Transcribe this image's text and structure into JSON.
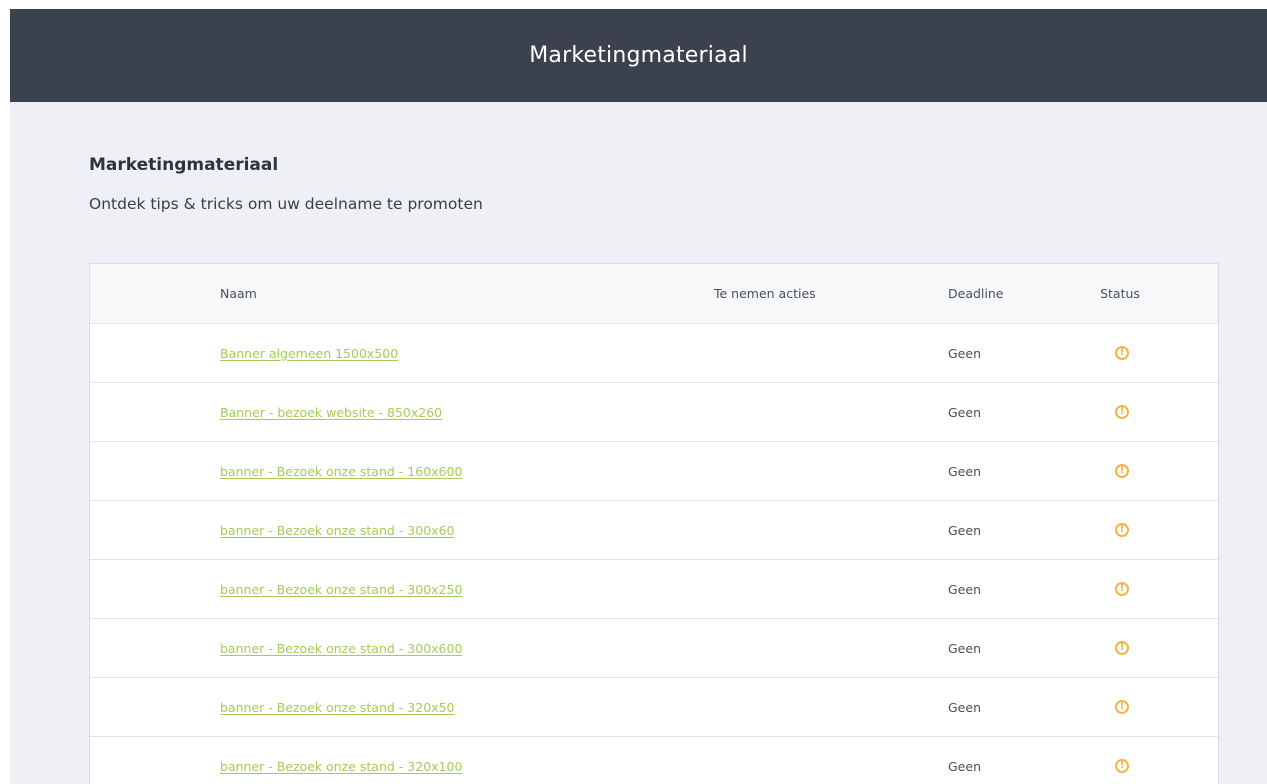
{
  "header": {
    "title": "Marketingmateriaal"
  },
  "page": {
    "title": "Marketingmateriaal",
    "subtitle": "Ontdek tips & tricks om uw deelname te promoten"
  },
  "table": {
    "columns": {
      "name": "Naam",
      "actions": "Te nemen acties",
      "deadline": "Deadline",
      "status": "Status"
    },
    "rows": [
      {
        "name": "Banner algemeen 1500x500",
        "actions": "",
        "deadline": "Geen",
        "status": "warning-icon"
      },
      {
        "name": "Banner - bezoek website - 850x260",
        "actions": "",
        "deadline": "Geen",
        "status": "warning-icon"
      },
      {
        "name": "banner - Bezoek onze stand - 160x600",
        "actions": "",
        "deadline": "Geen",
        "status": "warning-icon"
      },
      {
        "name": "banner - Bezoek onze stand - 300x60",
        "actions": "",
        "deadline": "Geen",
        "status": "warning-icon"
      },
      {
        "name": "banner - Bezoek onze stand - 300x250",
        "actions": "",
        "deadline": "Geen",
        "status": "warning-icon"
      },
      {
        "name": "banner - Bezoek onze stand - 300x600",
        "actions": "",
        "deadline": "Geen",
        "status": "warning-icon"
      },
      {
        "name": "banner - Bezoek onze stand - 320x50",
        "actions": "",
        "deadline": "Geen",
        "status": "warning-icon"
      },
      {
        "name": "banner - Bezoek onze stand - 320x100",
        "actions": "",
        "deadline": "Geen",
        "status": "warning-icon"
      }
    ]
  },
  "colors": {
    "header_bg": "#3c414e",
    "page_bg": "#eef0f5",
    "link": "#a5cc57",
    "status_warning": "#f2b545"
  }
}
